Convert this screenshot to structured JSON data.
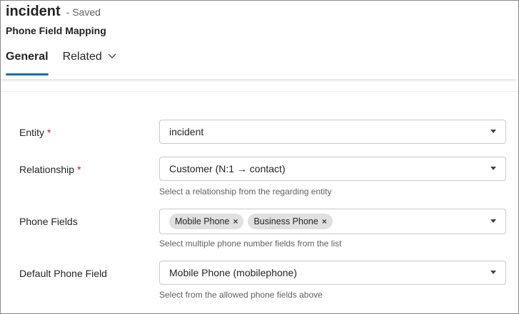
{
  "header": {
    "record_title": "incident",
    "save_status": "- Saved",
    "form_name": "Phone Field Mapping"
  },
  "tabs": [
    {
      "label": "General",
      "active": true
    },
    {
      "label": "Related",
      "active": false,
      "icon": "chevron-down-icon"
    }
  ],
  "fields": {
    "entity": {
      "label": "Entity",
      "required_mark": "*",
      "value": "incident"
    },
    "relationship": {
      "label": "Relationship",
      "required_mark": "*",
      "value": "Customer (N:1 → contact)",
      "helper": "Select a relationship from the regarding entity"
    },
    "phone_fields": {
      "label": "Phone Fields",
      "chips": [
        "Mobile Phone",
        "Business Phone"
      ],
      "chip_remove": "×",
      "helper": "Select multiple phone number fields from the list"
    },
    "default_phone_field": {
      "label": "Default Phone Field",
      "value": "Mobile Phone (mobilephone)",
      "helper": "Select from the allowed phone fields above"
    }
  },
  "colors": {
    "accent": "#0f6cbd",
    "required": "#c50f1f",
    "chip_bg": "#e0e0e0"
  }
}
